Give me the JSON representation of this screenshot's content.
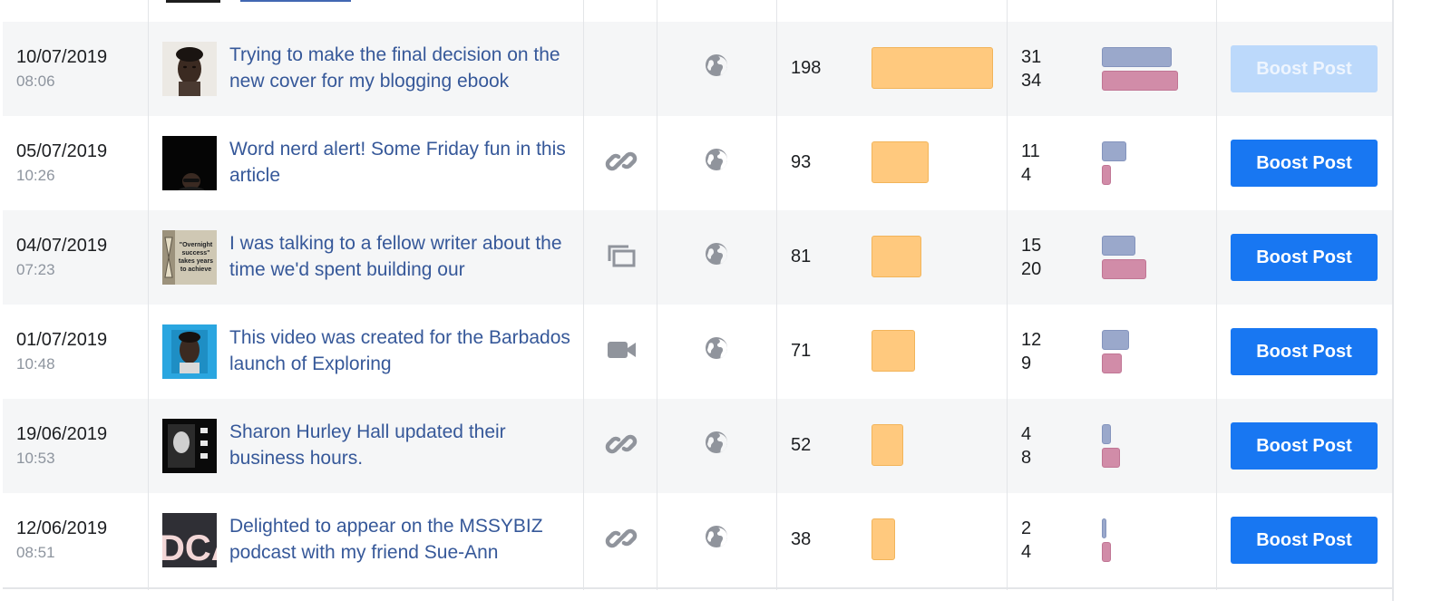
{
  "posts": [
    {
      "date": "10/07/2019",
      "time": "08:06",
      "text": "Trying to make the final decision on the new cover for my blogging ebook",
      "type_icon": "none",
      "audience_icon": "globe-icon",
      "reach": 198,
      "engagement_clicks": 31,
      "engagement_reactions": 34,
      "boost_label": "Boost Post",
      "boost_enabled": false
    },
    {
      "date": "05/07/2019",
      "time": "10:26",
      "text": "Word nerd alert! Some Friday fun in this article",
      "type_icon": "link-icon",
      "audience_icon": "globe-icon",
      "reach": 93,
      "engagement_clicks": 11,
      "engagement_reactions": 4,
      "boost_label": "Boost Post",
      "boost_enabled": true
    },
    {
      "date": "04/07/2019",
      "time": "07:23",
      "text": "I was talking to a fellow writer about the time we'd spent building our",
      "type_icon": "album-icon",
      "audience_icon": "globe-icon",
      "reach": 81,
      "engagement_clicks": 15,
      "engagement_reactions": 20,
      "boost_label": "Boost Post",
      "boost_enabled": true
    },
    {
      "date": "01/07/2019",
      "time": "10:48",
      "text": "This video was created for the Barbados launch of Exploring",
      "type_icon": "video-camera-icon",
      "audience_icon": "globe-icon",
      "reach": 71,
      "engagement_clicks": 12,
      "engagement_reactions": 9,
      "boost_label": "Boost Post",
      "boost_enabled": true
    },
    {
      "date": "19/06/2019",
      "time": "10:53",
      "text": "Sharon Hurley Hall updated their business hours.",
      "type_icon": "link-icon",
      "audience_icon": "globe-icon",
      "reach": 52,
      "engagement_clicks": 4,
      "engagement_reactions": 8,
      "boost_label": "Boost Post",
      "boost_enabled": true
    },
    {
      "date": "12/06/2019",
      "time": "08:51",
      "text": "Delighted to appear on the MSSYBIZ podcast with my friend Sue-Ann",
      "type_icon": "link-icon",
      "audience_icon": "globe-icon",
      "reach": 38,
      "engagement_clicks": 2,
      "engagement_reactions": 4,
      "boost_label": "Boost Post",
      "boost_enabled": true
    }
  ],
  "thumb_texts": {
    "quote_line1": "\"Overnight",
    "quote_line2": "success\"",
    "quote_line3": "takes years",
    "quote_line4": "to achieve",
    "podcast": "DCA"
  },
  "colors": {
    "link_text": "#365899",
    "reach_bar": "#ffc97e",
    "clicks_bar": "#9aa8cb",
    "reactions_bar": "#d18ca8",
    "boost_button": "#1877f2",
    "boost_button_disabled": "#bcd9fb",
    "icon_gray": "#90949c"
  }
}
